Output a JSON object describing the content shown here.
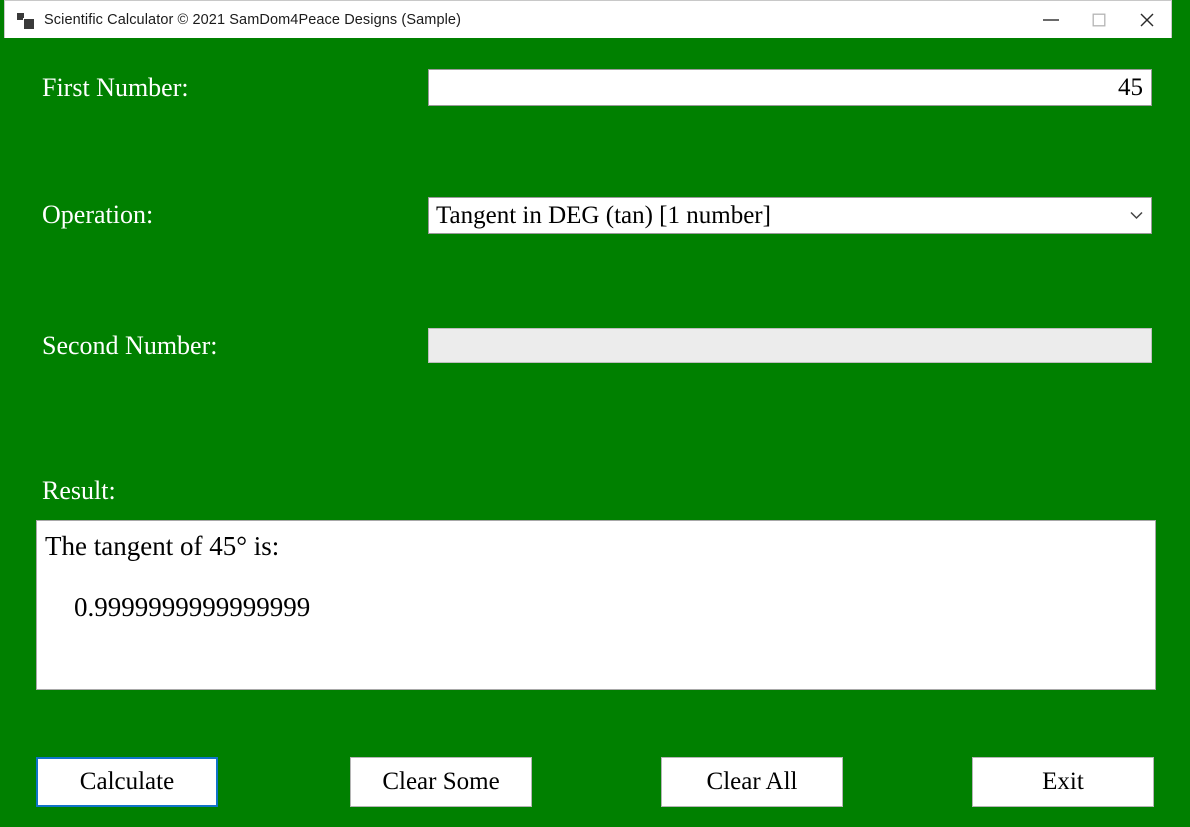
{
  "window": {
    "title": "Scientific Calculator © 2021 SamDom4Peace Designs (Sample)",
    "icon": "app-window-icon",
    "background_color": "#008000",
    "caption": {
      "minimize_label": "Minimize",
      "maximize_label": "Maximize",
      "close_label": "Close"
    }
  },
  "form": {
    "first_number": {
      "label": "First Number:",
      "value": "45",
      "placeholder": ""
    },
    "operation": {
      "label": "Operation:",
      "selected": "Tangent in DEG (tan) [1 number]",
      "chevron": "chevron-down-icon"
    },
    "second_number": {
      "label": "Second Number:",
      "value": "",
      "placeholder": "",
      "disabled": true
    },
    "result": {
      "label": "Result:",
      "line1": "The tangent of 45° is:",
      "line2": "0.9999999999999999"
    }
  },
  "buttons": {
    "calculate": "Calculate",
    "clear_some": "Clear Some",
    "clear_all": "Clear All",
    "exit": "Exit",
    "focus_accent_color": "#0f73c8"
  }
}
